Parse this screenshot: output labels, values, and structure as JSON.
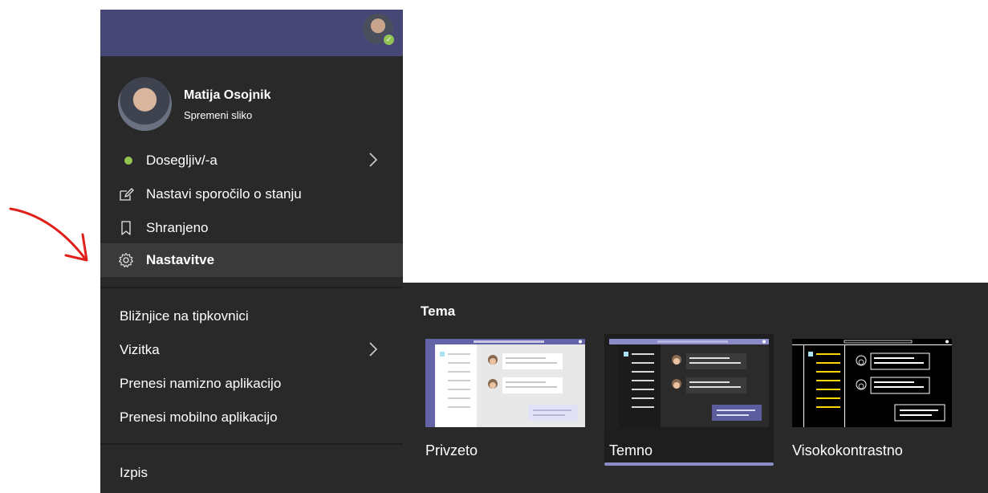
{
  "profile": {
    "name": "Matija Osojnik",
    "change_photo": "Spremeni sliko"
  },
  "menu": {
    "status": "Dosegljiv/-a",
    "status_message": "Nastavi sporočilo o stanju",
    "saved": "Shranjeno",
    "settings": "Nastavitve",
    "keyboard_shortcuts": "Bližnjice na tipkovnici",
    "business_card": "Vizitka",
    "download_desktop": "Prenesi namizno aplikacijo",
    "download_mobile": "Prenesi mobilno aplikacijo",
    "sign_out": "Izpis"
  },
  "theme": {
    "title": "Tema",
    "options": [
      {
        "label": "Privzeto",
        "selected": false
      },
      {
        "label": "Temno",
        "selected": true
      },
      {
        "label": "Visokokontrastno",
        "selected": false
      }
    ]
  },
  "colors": {
    "header": "#464775",
    "menu_bg": "#292929",
    "status_green": "#92c353",
    "accent": "#8b8cc7",
    "annotation_red": "#e0201b"
  },
  "icons": {
    "status": "green-dot-icon",
    "status_message": "edit-icon",
    "saved": "bookmark-icon",
    "settings": "gear-icon",
    "submenu": "chevron-right-icon"
  }
}
